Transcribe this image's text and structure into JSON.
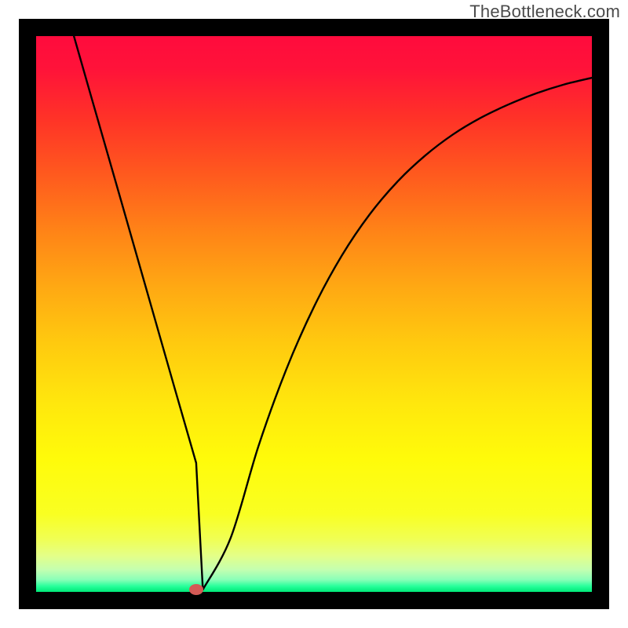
{
  "watermark": {
    "text": "TheBottleneck.com"
  },
  "chart_data": {
    "type": "line",
    "title": "",
    "xlabel": "",
    "ylabel": "",
    "xlim": [
      0,
      100
    ],
    "ylim": [
      0,
      100
    ],
    "grid": false,
    "legend": false,
    "series": [
      {
        "name": "bottleneck-curve",
        "x": [
          6.8,
          10,
          15,
          20,
          25,
          28.8,
          30,
          35,
          40,
          45,
          50,
          55,
          60,
          65,
          70,
          75,
          80,
          85,
          90,
          95,
          100
        ],
        "y": [
          100,
          88.8,
          71.4,
          53.9,
          36.4,
          23.2,
          0.4,
          9.7,
          26.2,
          40.0,
          51.3,
          60.5,
          67.9,
          73.8,
          78.5,
          82.3,
          85.3,
          87.7,
          89.7,
          91.3,
          92.5
        ]
      }
    ],
    "markers": [
      {
        "name": "optimal-point",
        "x": 28.8,
        "y": 0.4,
        "color": "#d45a56"
      }
    ],
    "background_gradient": {
      "type": "vertical-heat-scale",
      "stops": [
        {
          "pos": 0.0,
          "color": "#ff0b3d"
        },
        {
          "pos": 0.06,
          "color": "#ff1339"
        },
        {
          "pos": 0.15,
          "color": "#ff3327"
        },
        {
          "pos": 0.25,
          "color": "#ff5a1e"
        },
        {
          "pos": 0.35,
          "color": "#ff8317"
        },
        {
          "pos": 0.45,
          "color": "#ffa813"
        },
        {
          "pos": 0.55,
          "color": "#ffc90f"
        },
        {
          "pos": 0.66,
          "color": "#ffe70d"
        },
        {
          "pos": 0.76,
          "color": "#fffb0a"
        },
        {
          "pos": 0.86,
          "color": "#f9ff22"
        },
        {
          "pos": 0.905,
          "color": "#f0ff54"
        },
        {
          "pos": 0.935,
          "color": "#e4ff88"
        },
        {
          "pos": 0.96,
          "color": "#c4ffb0"
        },
        {
          "pos": 0.978,
          "color": "#8affb8"
        },
        {
          "pos": 0.99,
          "color": "#26ff9a"
        },
        {
          "pos": 1.0,
          "color": "#00e878"
        }
      ]
    }
  }
}
